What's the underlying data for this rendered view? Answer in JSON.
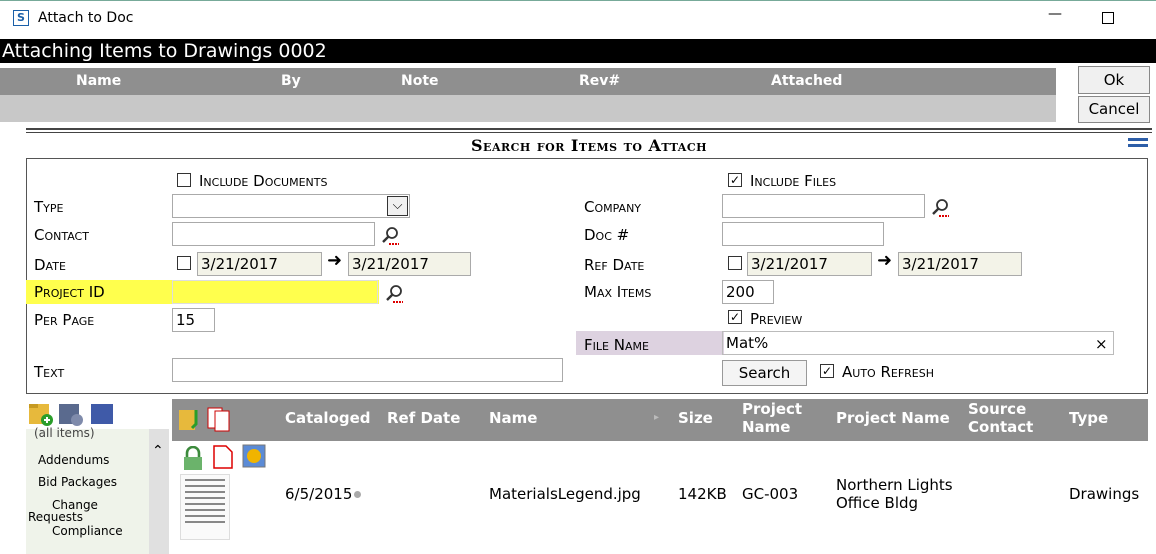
{
  "window": {
    "title": "Attach to Doc",
    "minimize": "—"
  },
  "header": {
    "title": "Attaching Items to Drawings 0002"
  },
  "attached_columns": [
    "Name",
    "By",
    "Note",
    "Rev#",
    "Attached"
  ],
  "buttons": {
    "ok": "Ok",
    "cancel": "Cancel",
    "search": "Search"
  },
  "search": {
    "title": "Search for Items to Attach",
    "include_documents": {
      "label": "Include Documents",
      "checked": false
    },
    "include_files": {
      "label": "Include Files",
      "checked": true
    },
    "type_label": "Type",
    "type_value": "",
    "contact_label": "Contact",
    "contact_value": "",
    "date_label": "Date",
    "date_from": "3/21/2017",
    "date_to": "3/21/2017",
    "project_id_label": "Project ID",
    "project_id_value": "",
    "per_page_label": "Per Page",
    "per_page_value": "15",
    "text_label": "Text",
    "text_value": "",
    "company_label": "Company",
    "company_value": "",
    "doc_label": "Doc #",
    "doc_value": "",
    "ref_date_label": "Ref Date",
    "ref_date_from": "3/21/2017",
    "ref_date_to": "3/21/2017",
    "max_items_label": "Max Items",
    "max_items_value": "200",
    "preview": {
      "label": "Preview",
      "checked": true
    },
    "file_name_label": "File Name",
    "file_name_value": "Mat%",
    "clear_symbol": "×",
    "auto_refresh": {
      "label": "Auto Refresh",
      "checked": true
    }
  },
  "tree": {
    "items": [
      "(all items)",
      "Addendums",
      "Bid Packages",
      "Change",
      "Requests",
      "Compliance"
    ]
  },
  "results": {
    "columns": {
      "cataloged": "Cataloged",
      "ref_date": "Ref Date",
      "name": "Name",
      "size": "Size",
      "project_name_1": "Project",
      "project_name_2": "Name",
      "project_full": "Project Name",
      "source_1": "Source",
      "source_2": "Contact",
      "type": "Type"
    },
    "rows": [
      {
        "cataloged": "6/5/2015",
        "name": "MaterialsLegend.jpg",
        "size": "142KB",
        "project": "GC-003",
        "project_name_1": "Northern Lights",
        "project_name_2": "Office Bldg",
        "type": "Drawings"
      }
    ]
  },
  "colors": {
    "header_bg": "#000000",
    "column_bar": "#8f8f8f",
    "highlight_yellow": "#ffff4d",
    "highlight_purple": "#ddd2e0",
    "accent_blue": "#2d5ea8"
  }
}
